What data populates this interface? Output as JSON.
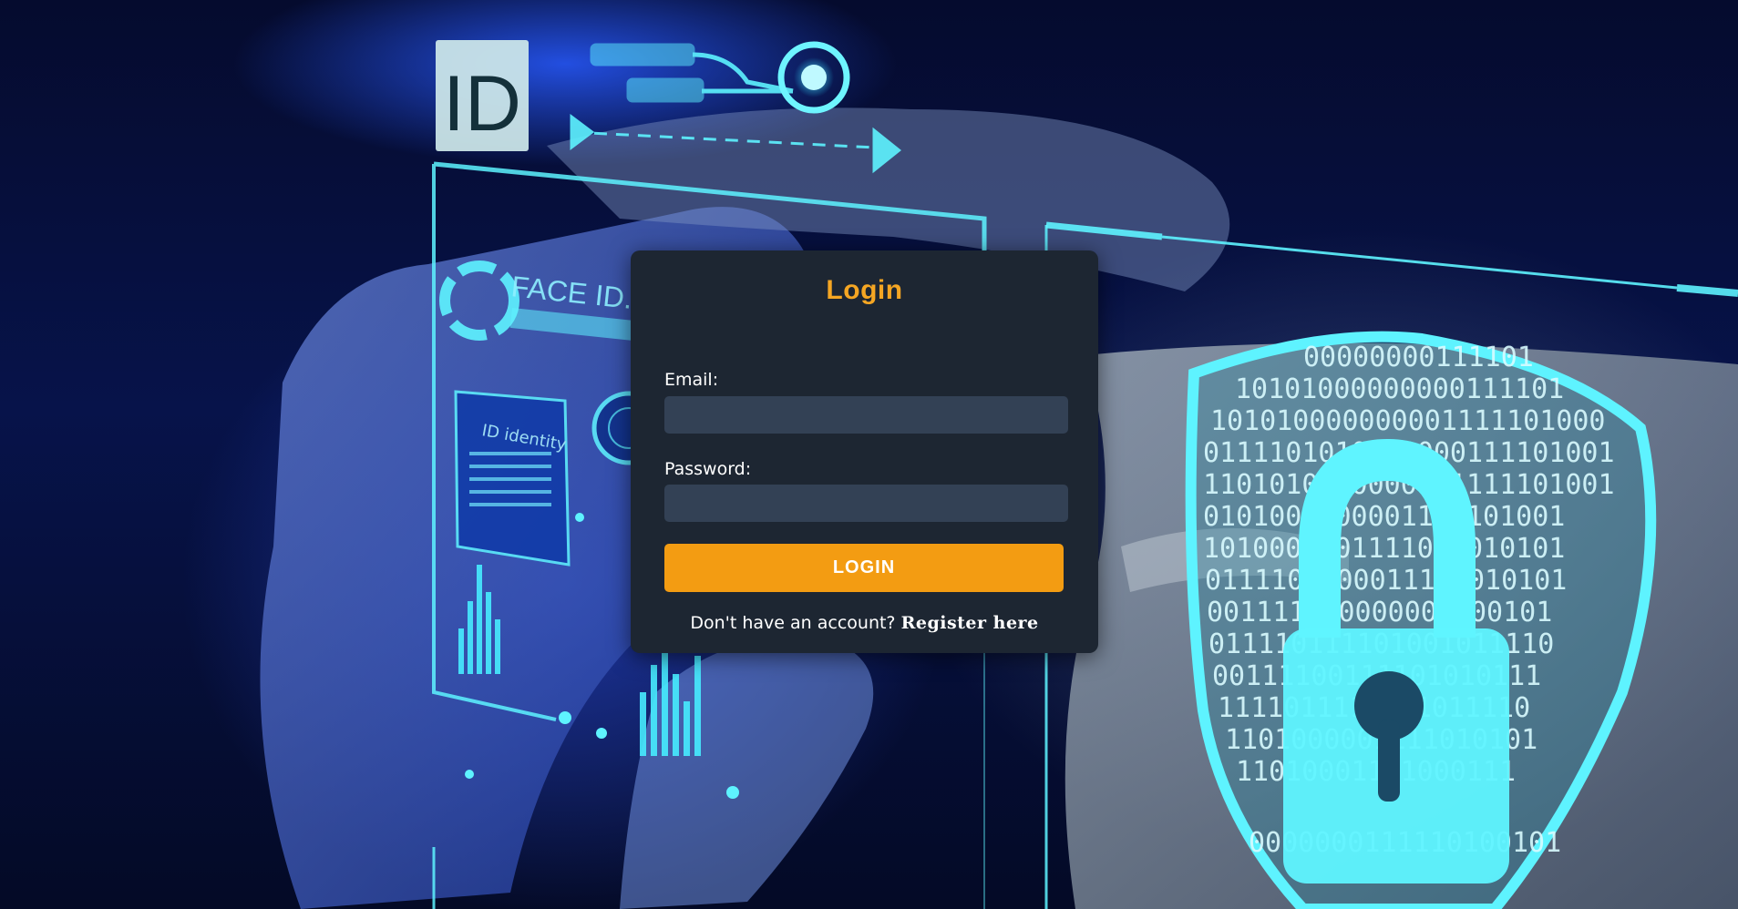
{
  "login": {
    "title": "Login",
    "email_label": "Email:",
    "email_value": "",
    "password_label": "Password:",
    "password_value": "",
    "submit_label": "LOGIN",
    "register_prompt": "Don't have an account?",
    "register_link": "Register here"
  },
  "background": {
    "id_badge_text": "ID",
    "face_id_text": "FACE ID.CONF",
    "id_identity_text": "ID identity",
    "binary_rows": [
      "00000000111101",
      "10101000000000111101",
      "101010000000001111101000",
      "0111101010000000111101001",
      "1101010000000001111101001",
      "0101000000001111101001",
      "1010000001111010010101",
      "0111101000011110010101",
      "001111000000000100101",
      "011110111101001011110",
      "00111100111101010111",
      "1111011110101011110",
      "1101000001111010101",
      "11010001101000111",
      "0000000111110100101"
    ]
  },
  "colors": {
    "accent": "#f39c12",
    "title": "#f5a623",
    "card_bg": "#1d2632",
    "input_bg": "#334155",
    "hud_cyan": "#5ef3ff"
  },
  "icons": [
    "padlock-icon",
    "shield-icon",
    "face-id-icon",
    "fingerprint-scanner-icon"
  ]
}
